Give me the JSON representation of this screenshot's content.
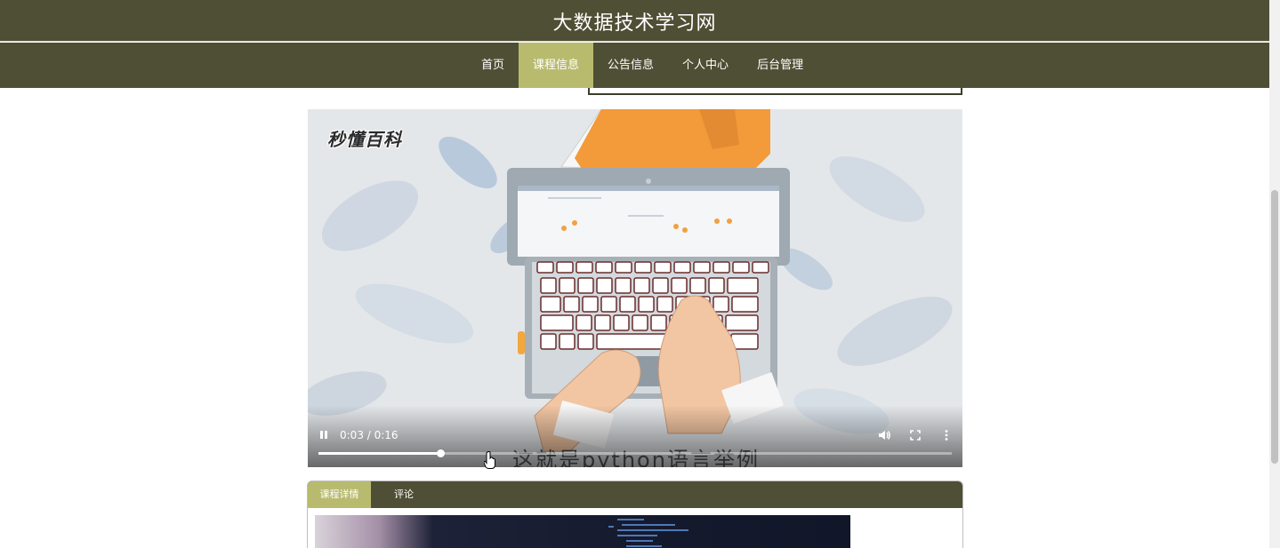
{
  "header": {
    "site_title": "大数据技术学习网"
  },
  "nav": {
    "items": [
      {
        "label": "首页",
        "active": false
      },
      {
        "label": "课程信息",
        "active": true
      },
      {
        "label": "公告信息",
        "active": false
      },
      {
        "label": "个人中心",
        "active": false
      },
      {
        "label": "后台管理",
        "active": false
      }
    ]
  },
  "video": {
    "logo_text": "秒懂百科",
    "subtitle": "这就是python语言举例",
    "time_display": "0:03 / 0:16",
    "progress_fraction": 0.1919,
    "state": "playing",
    "controls": [
      "pause-icon",
      "volume-icon",
      "fullscreen-icon",
      "more-vert-icon"
    ]
  },
  "tabs": {
    "items": [
      {
        "label": "课程详情",
        "active": true
      },
      {
        "label": "评论",
        "active": false
      }
    ]
  },
  "colors": {
    "nav_bg": "#4f4f35",
    "active_tab": "#b8bb6e",
    "header_text": "#ffffff"
  }
}
